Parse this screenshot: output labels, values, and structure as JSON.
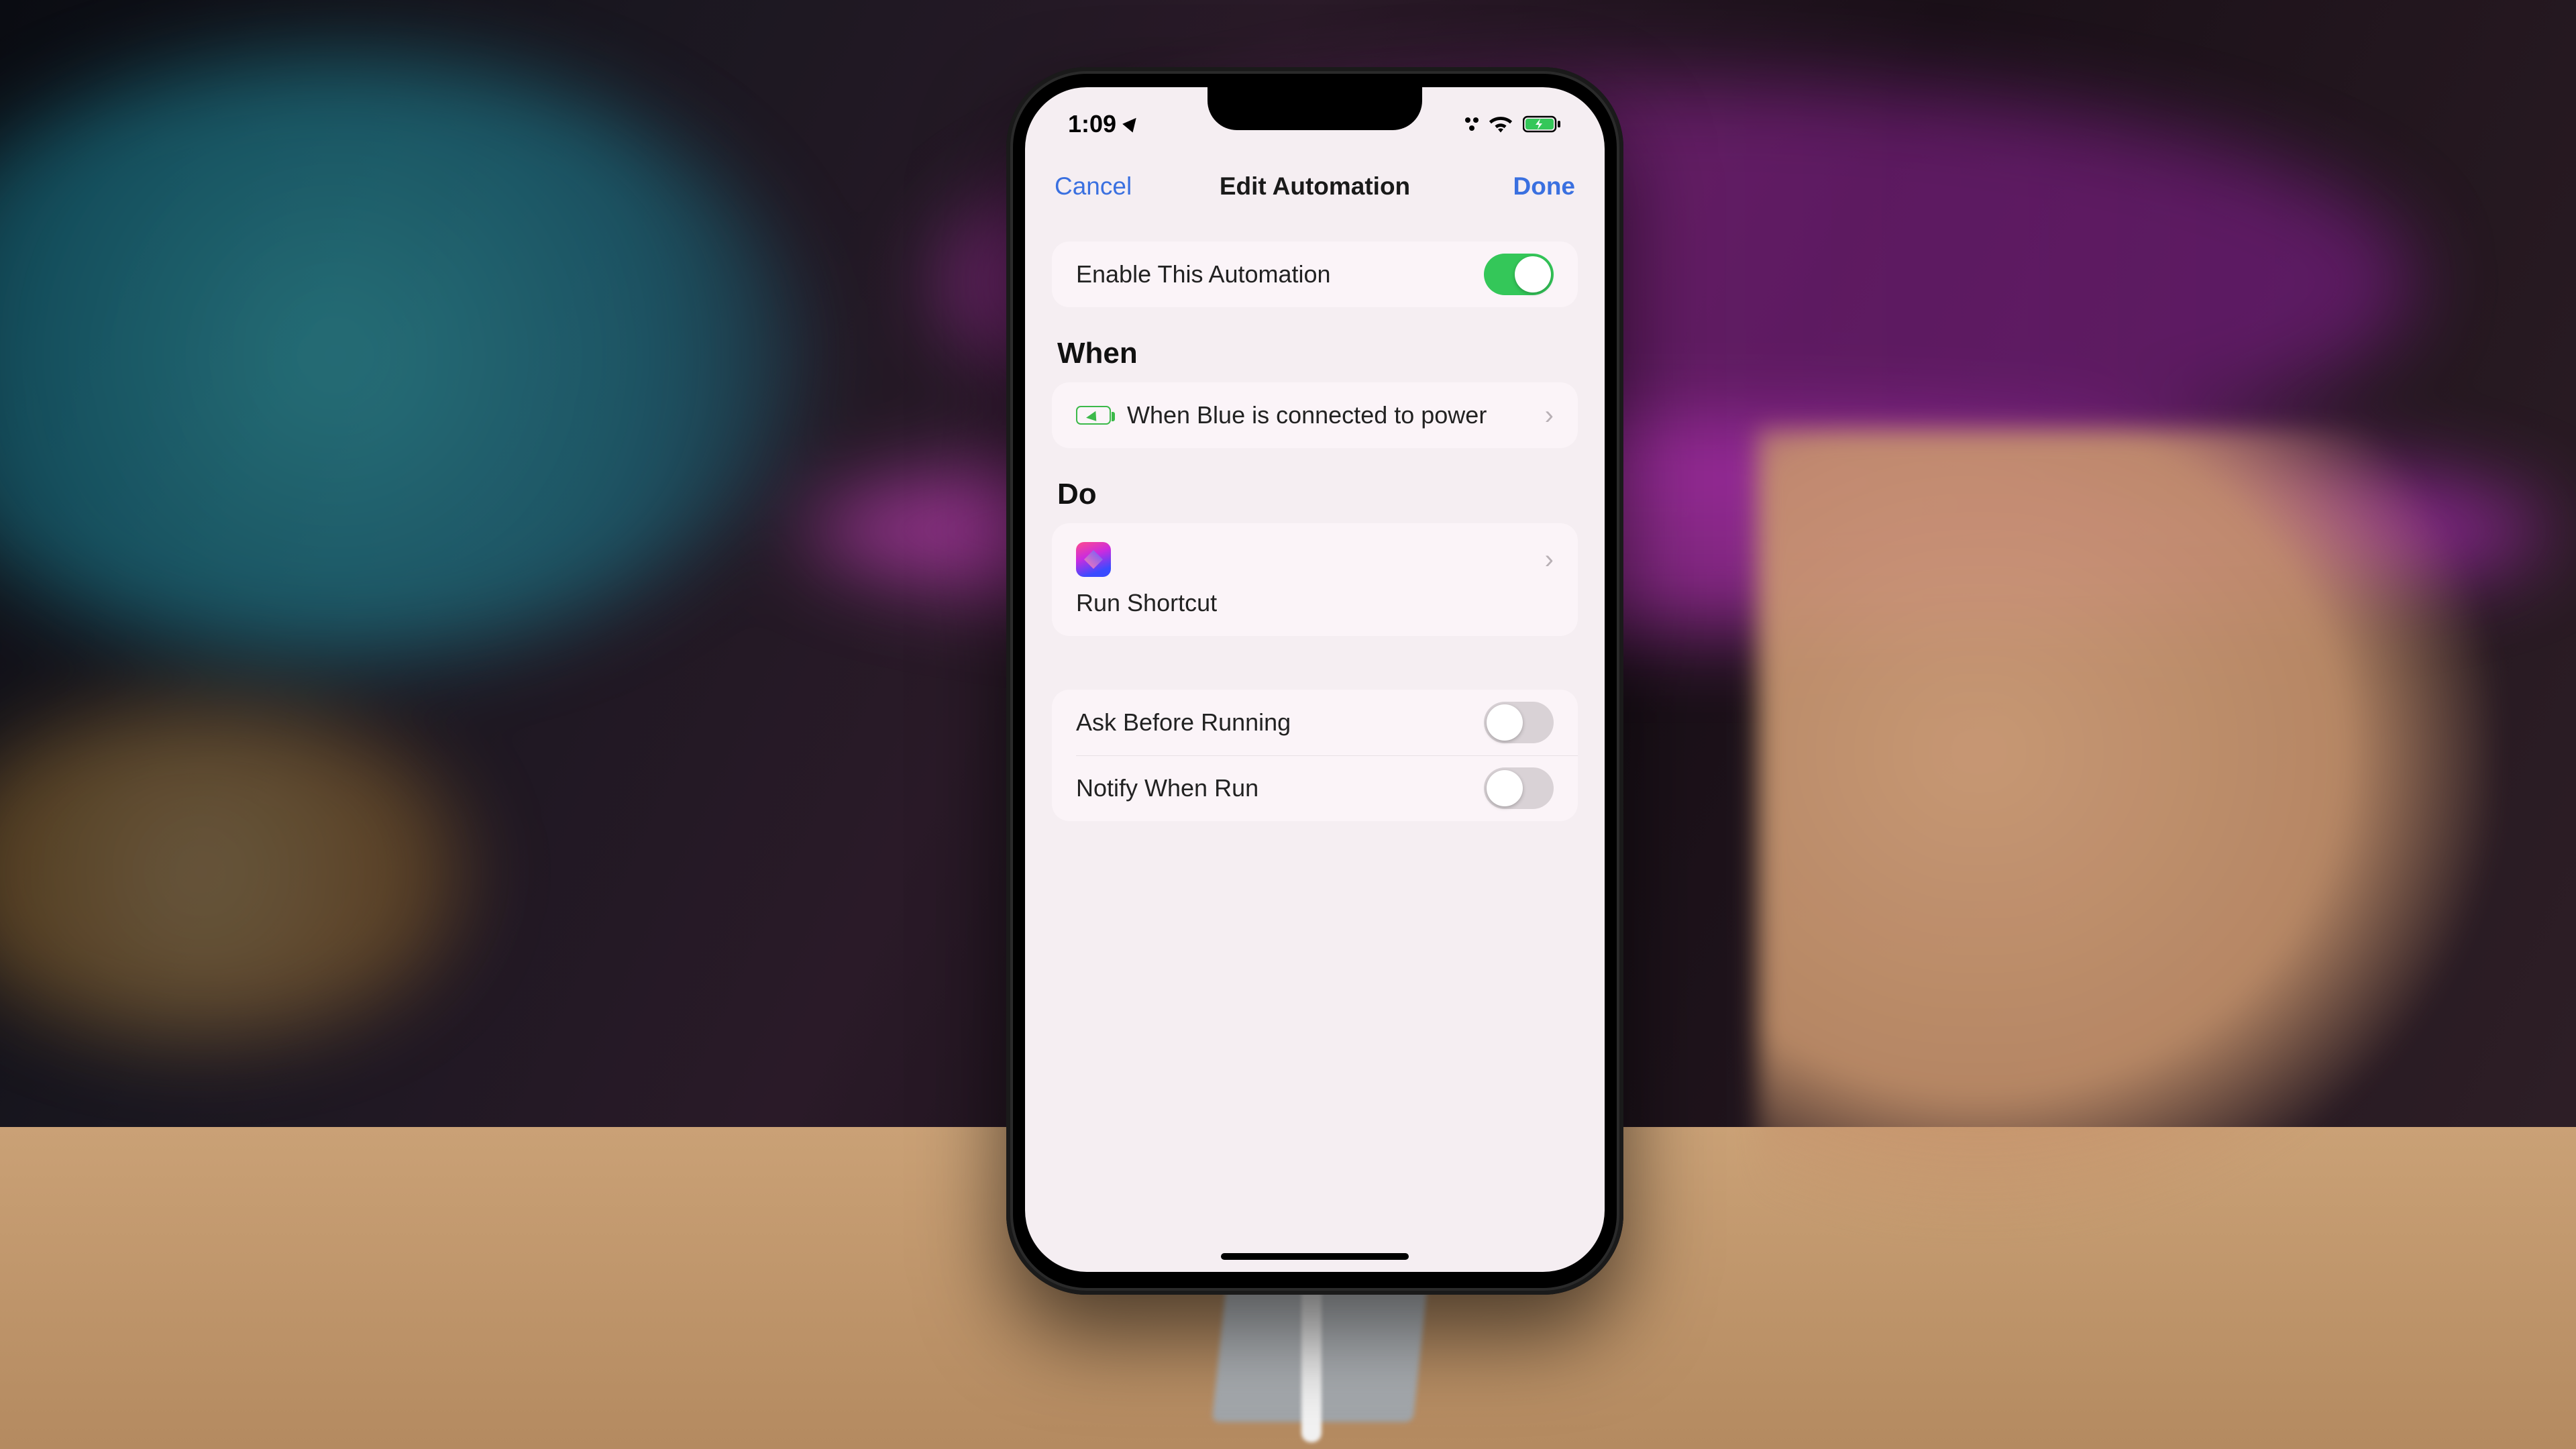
{
  "status": {
    "time": "1:09"
  },
  "nav": {
    "cancel": "Cancel",
    "title": "Edit Automation",
    "done": "Done"
  },
  "enable": {
    "label": "Enable This Automation",
    "on": true
  },
  "when": {
    "heading": "When",
    "row_label": "When Blue is connected to power"
  },
  "do_section": {
    "heading": "Do",
    "row_label": "Run Shortcut"
  },
  "options": {
    "ask": {
      "label": "Ask Before Running",
      "on": false
    },
    "notify": {
      "label": "Notify When Run",
      "on": false
    }
  }
}
